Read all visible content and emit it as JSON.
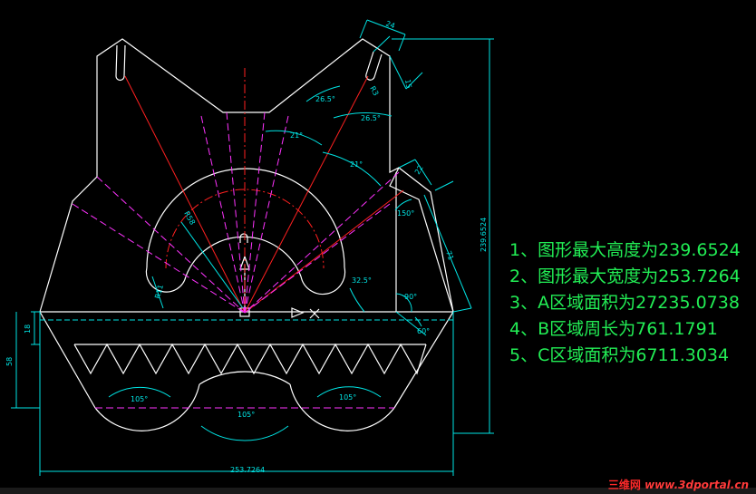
{
  "drawing": {
    "dimensions": {
      "top_width": "24",
      "slot_depth": "15",
      "slot_radius": "R3",
      "angle_left_slot": "26.5°",
      "angle_right_slot": "26.5°",
      "angle_21_left": "21°",
      "angle_21_right": "21°",
      "right_small_width": "22",
      "angle_150": "150°",
      "side_length": "71",
      "radius_r58": "R58",
      "radius_r11": "R11",
      "angle_32_5": "32.5°",
      "angle_90": "90°",
      "angle_60": "60°",
      "overall_height": "239.6524",
      "dim_18": "18",
      "dim_58": "58",
      "angle_105_left": "105°",
      "angle_105_right": "105°",
      "angle_105_bottom": "105°",
      "overall_width": "253.7264"
    },
    "notes": [
      "1、图形最大高度为239.6524",
      "2、图形最大宽度为253.7264",
      "3、A区域面积为27235.0738",
      "4、B区域周长为761.1791",
      "5、C区域面积为6711.3034"
    ],
    "watermark": {
      "cn": "三维网",
      "url": "www.3dportal.cn"
    }
  },
  "colors": {
    "background": "#000000",
    "outline": "#ffffff",
    "dimension": "#00e5e5",
    "center_line": "#ff2020",
    "construction": "#ff33ff",
    "notes": "#22ee55",
    "watermark": "#ff2a2a"
  }
}
